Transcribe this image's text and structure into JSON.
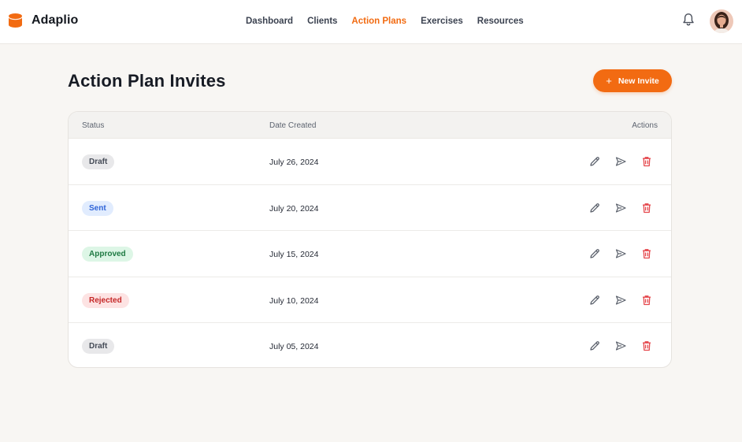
{
  "app": {
    "name": "Adaplio"
  },
  "nav": {
    "items": [
      {
        "label": "Dashboard",
        "active": false
      },
      {
        "label": "Clients",
        "active": false
      },
      {
        "label": "Action Plans",
        "active": true
      },
      {
        "label": "Exercises",
        "active": false
      },
      {
        "label": "Resources",
        "active": false
      }
    ]
  },
  "header_icons": {
    "notifications": "bell-icon",
    "profile": "user-avatar"
  },
  "page": {
    "title": "Action Plan Invites",
    "new_button": {
      "label": "New Invite",
      "icon": "plus-icon"
    }
  },
  "table": {
    "columns": [
      "Status",
      "Date Created",
      "Actions"
    ],
    "rows": [
      {
        "status": "Draft",
        "status_type": "draft",
        "date": "July 26, 2024"
      },
      {
        "status": "Sent",
        "status_type": "sent",
        "date": "July 20, 2024"
      },
      {
        "status": "Approved",
        "status_type": "approved",
        "date": "July 15, 2024"
      },
      {
        "status": "Rejected",
        "status_type": "rejected",
        "date": "July 10, 2024"
      },
      {
        "status": "Draft",
        "status_type": "draft",
        "date": "July 05, 2024"
      }
    ],
    "row_actions": [
      "edit-icon",
      "send-icon",
      "delete-icon"
    ]
  },
  "colors": {
    "accent": "#f26b12",
    "draft": "#e8e8ea",
    "sent": "#e1ecfe",
    "approved": "#ddf6e6",
    "rejected": "#fde3e3",
    "delete": "#e5484d"
  }
}
